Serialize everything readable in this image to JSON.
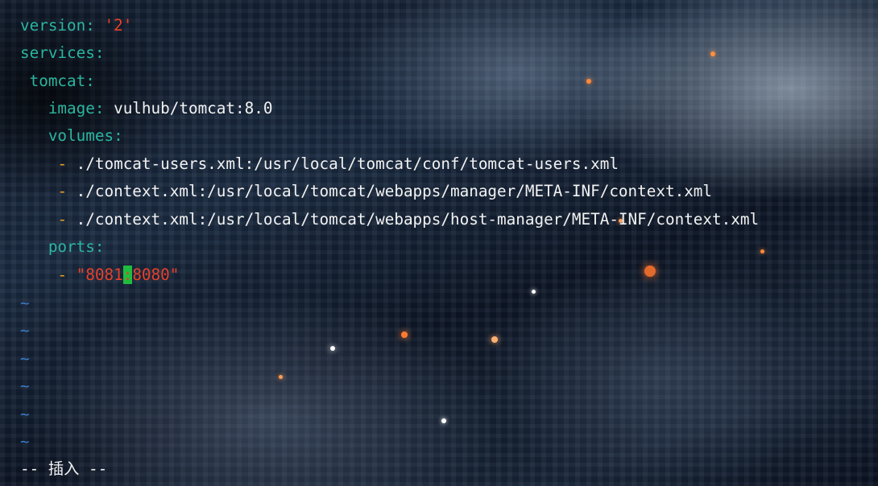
{
  "editor": {
    "version_key": "version",
    "version_value": "'2'",
    "services_key": "services",
    "tomcat_key": "tomcat",
    "image_key": "image",
    "image_value": "vulhub/tomcat:8.0",
    "volumes_key": "volumes",
    "volumes": [
      "./tomcat-users.xml:/usr/local/tomcat/conf/tomcat-users.xml",
      "./context.xml:/usr/local/tomcat/webapps/manager/META-INF/context.xml",
      "./context.xml:/usr/local/tomcat/webapps/host-manager/META-INF/context.xml"
    ],
    "ports_key": "ports",
    "port_before_cursor": "\"8081",
    "port_cursor_char": ":",
    "port_after_cursor": "8080\"",
    "colon": ":",
    "dash": "-",
    "tilde": "~"
  },
  "status_line": "-- 插入 --"
}
